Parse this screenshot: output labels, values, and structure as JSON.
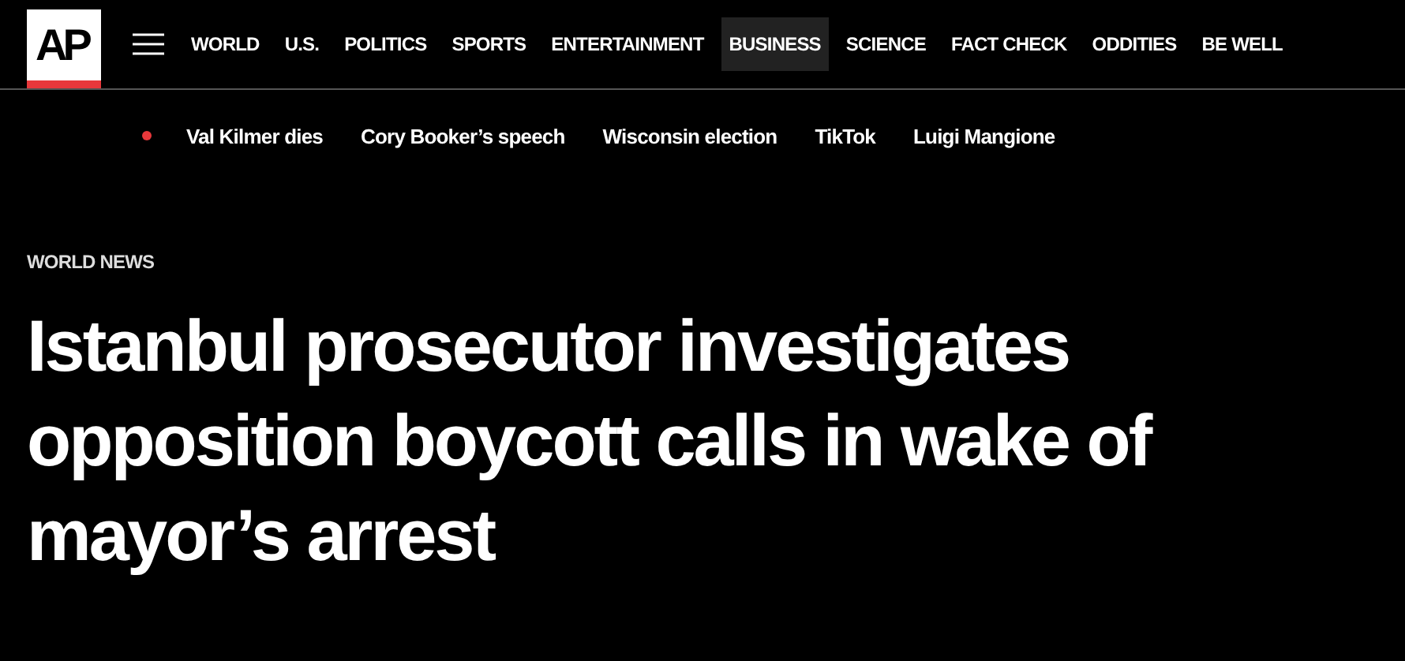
{
  "logo": {
    "text": "AP"
  },
  "nav": [
    {
      "label": "WORLD",
      "selected": false
    },
    {
      "label": "U.S.",
      "selected": false
    },
    {
      "label": "POLITICS",
      "selected": false
    },
    {
      "label": "SPORTS",
      "selected": false
    },
    {
      "label": "ENTERTAINMENT",
      "selected": false
    },
    {
      "label": "BUSINESS",
      "selected": true
    },
    {
      "label": "SCIENCE",
      "selected": false
    },
    {
      "label": "FACT CHECK",
      "selected": false
    },
    {
      "label": "ODDITIES",
      "selected": false
    },
    {
      "label": "BE WELL",
      "selected": false
    }
  ],
  "trending": {
    "items": [
      "Val Kilmer dies",
      "Cory Booker’s speech",
      "Wisconsin election",
      "TikTok",
      "Luigi Mangione"
    ]
  },
  "article": {
    "section": "WORLD NEWS",
    "headline": "Istanbul prosecutor investigates opposition boycott calls in wake of mayor’s arrest"
  }
}
